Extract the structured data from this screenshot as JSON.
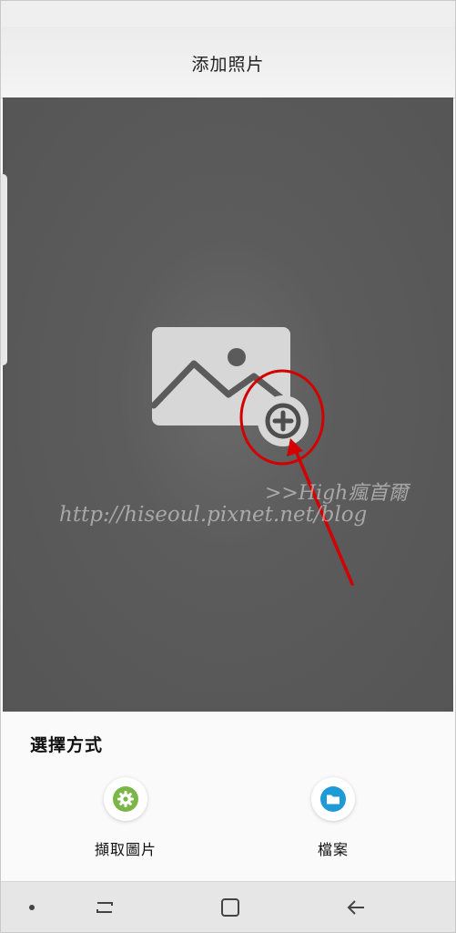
{
  "header": {
    "title": "添加照片"
  },
  "canvas": {
    "placeholder_icon": "image-placeholder-icon",
    "add_icon": "plus-circle-icon",
    "watermark_line1": ">>High瘋首爾",
    "watermark_line2": "http://hiseoul.pixnet.net/blog",
    "annotation_color": "#d20000"
  },
  "sheet": {
    "title": "選擇方式",
    "options": [
      {
        "label": "擷取圖片",
        "icon": "gear-icon",
        "color": "#7ab648"
      },
      {
        "label": "檔案",
        "icon": "folder-icon",
        "color": "#1e9ad6"
      }
    ]
  },
  "navbar": {
    "buttons": [
      "dot-icon",
      "recent-apps-icon",
      "home-icon",
      "back-icon"
    ]
  }
}
